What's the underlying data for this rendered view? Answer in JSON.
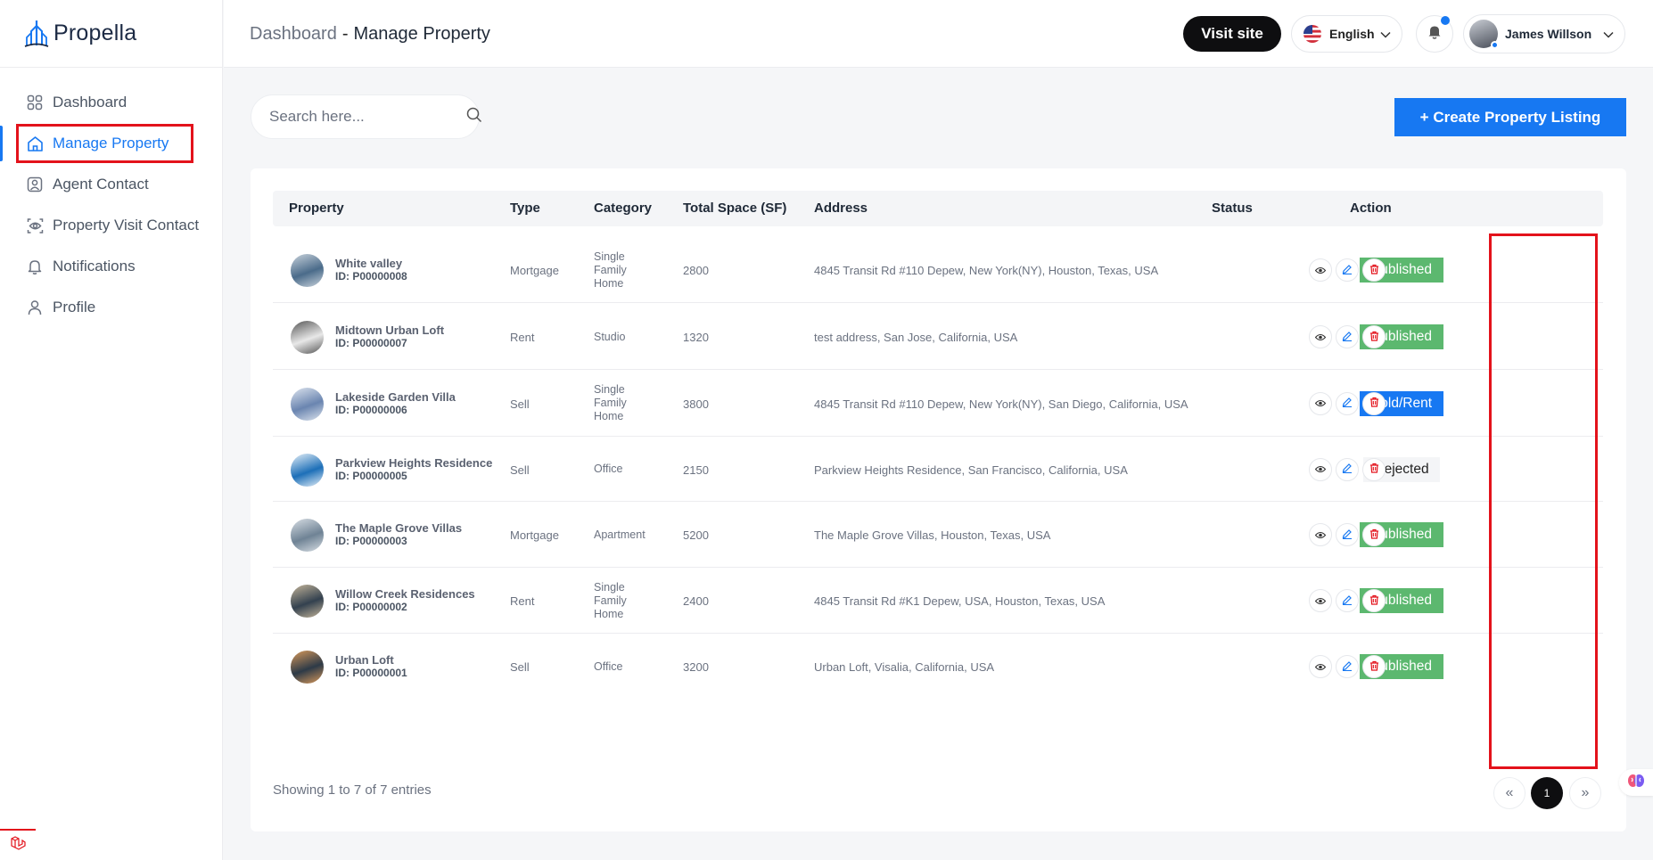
{
  "app": {
    "name": "Propella"
  },
  "sidebar": {
    "items": [
      {
        "label": "Dashboard",
        "icon": "grid-icon"
      },
      {
        "label": "Manage Property",
        "icon": "home-icon",
        "active": true
      },
      {
        "label": "Agent Contact",
        "icon": "contact-icon"
      },
      {
        "label": "Property Visit Contact",
        "icon": "eye-icon"
      },
      {
        "label": "Notifications",
        "icon": "bell-icon"
      },
      {
        "label": "Profile",
        "icon": "user-icon"
      }
    ]
  },
  "header": {
    "breadcrumb_root": "Dashboard",
    "breadcrumb_sep": "-",
    "breadcrumb_current": "Manage Property",
    "visit_site": "Visit site",
    "language": "English",
    "user_name": "James Willson"
  },
  "toolbar": {
    "search_placeholder": "Search here...",
    "create_button": "+ Create Property Listing"
  },
  "table": {
    "columns": {
      "property": "Property",
      "type": "Type",
      "category": "Category",
      "space": "Total Space (SF)",
      "address": "Address",
      "status": "Status",
      "action": "Action"
    },
    "rows": [
      {
        "name": "White valley",
        "id": "ID: P00000008",
        "type": "Mortgage",
        "category": [
          "Single",
          "Family",
          "Home"
        ],
        "space": "2800",
        "address": "4845 Transit Rd #110 Depew, New York(NY), Houston, Texas, USA",
        "status": "Published"
      },
      {
        "name": "Midtown Urban Loft",
        "id": "ID: P00000007",
        "type": "Rent",
        "category": [
          "Studio"
        ],
        "space": "1320",
        "address": "test address, San Jose, California, USA",
        "status": "Published"
      },
      {
        "name": "Lakeside Garden Villa",
        "id": "ID: P00000006",
        "type": "Sell",
        "category": [
          "Single",
          "Family",
          "Home"
        ],
        "space": "3800",
        "address": "4845 Transit Rd #110 Depew, New York(NY), San Diego, California, USA",
        "status": "Sold/Rent"
      },
      {
        "name": "Parkview Heights Residence",
        "id": "ID: P00000005",
        "type": "Sell",
        "category": [
          "Office"
        ],
        "space": "2150",
        "address": "Parkview Heights Residence, San Francisco, California, USA",
        "status": "Rejected"
      },
      {
        "name": "The Maple Grove Villas",
        "id": "ID: P00000003",
        "type": "Mortgage",
        "category": [
          "Apartment"
        ],
        "space": "5200",
        "address": "The Maple Grove Villas, Houston, Texas, USA",
        "status": "Published"
      },
      {
        "name": "Willow Creek Residences",
        "id": "ID: P00000002",
        "type": "Rent",
        "category": [
          "Single",
          "Family",
          "Home"
        ],
        "space": "2400",
        "address": "4845 Transit Rd #K1 Depew, USA, Houston, Texas, USA",
        "status": "Published"
      },
      {
        "name": "Urban Loft",
        "id": "ID: P00000001",
        "type": "Sell",
        "category": [
          "Office"
        ],
        "space": "3200",
        "address": "Urban Loft, Visalia, California, USA",
        "status": "Published"
      }
    ]
  },
  "footer": {
    "entries_text": "Showing 1 to 7 of 7 entries",
    "prev": "«",
    "current_page": "1",
    "next": "»"
  },
  "colors": {
    "accent": "#1778f2",
    "published": "#5cb86f",
    "highlight": "#e3121b",
    "delete": "#e3121b"
  }
}
